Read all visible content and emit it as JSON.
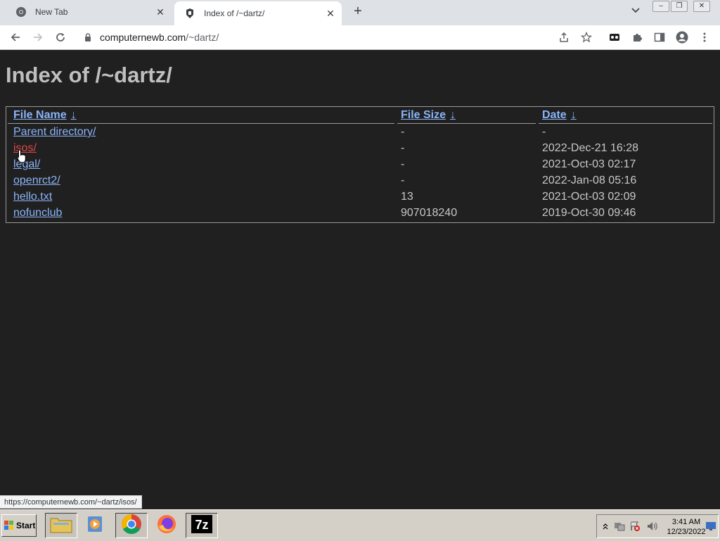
{
  "browser": {
    "tabs": [
      {
        "title": "New Tab",
        "icon": "chrome-icon",
        "active": false
      },
      {
        "title": "Index of /~dartz/",
        "icon": "site-favicon-icon",
        "active": true
      }
    ],
    "url_host": "computernewb.com",
    "url_path": "/~dartz/"
  },
  "page": {
    "heading": "Index of /~dartz/",
    "columns": {
      "name": "File Name",
      "size": "File Size",
      "date": "Date",
      "sort_arrow": "↓"
    },
    "rows": [
      {
        "name": "Parent directory/",
        "size": "-",
        "date": "-"
      },
      {
        "name": "isos/",
        "size": "-",
        "date": "2022-Dec-21 16:28"
      },
      {
        "name": "legal/",
        "size": "-",
        "date": "2021-Oct-03 02:17"
      },
      {
        "name": "openrct2/",
        "size": "-",
        "date": "2022-Jan-08 05:16"
      },
      {
        "name": "hello.txt",
        "size": "13",
        "date": "2021-Oct-03 02:09"
      },
      {
        "name": "nofunclub",
        "size": "907018240",
        "date": "2019-Oct-30 09:46"
      }
    ],
    "hovered_row": 1
  },
  "statusbar": {
    "text": "https://computernewb.com/~dartz/isos/"
  },
  "taskbar": {
    "start_label": "Start",
    "clock_time": "3:41 AM",
    "clock_date": "12/23/2022"
  },
  "colors": {
    "page_bg": "#202020",
    "link": "#8ab4f8",
    "link_hover": "#e04848",
    "heading": "#bfbfbf"
  }
}
